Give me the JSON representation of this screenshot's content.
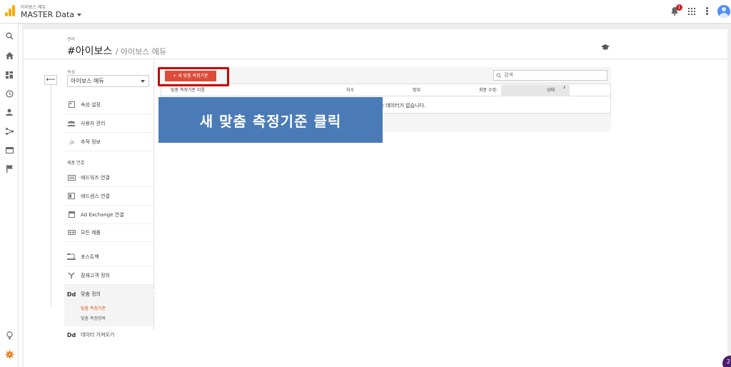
{
  "header": {
    "account_name": "아이보스 에듀",
    "property_name": "MASTER Data",
    "notification_count": "1"
  },
  "page": {
    "breadcrumb_label": "관리",
    "title": "#아이보스",
    "title_sub": "/ 아이보스 에듀"
  },
  "property_section": {
    "label": "속성",
    "selected": "아이보스 에듀"
  },
  "nav": {
    "items": [
      {
        "label": "속성 설정",
        "icon": "settings-page-icon"
      },
      {
        "label": "사용자 관리",
        "icon": "users-icon"
      },
      {
        "label": "추적 정보",
        "icon": "js-icon"
      }
    ],
    "product_linking_label": "제품 연결",
    "product_items": [
      {
        "label": "애드워즈 연결",
        "icon": "adwords-icon"
      },
      {
        "label": "애드센스 연결",
        "icon": "adsense-icon"
      },
      {
        "label": "Ad Exchange 연결",
        "icon": "ad-exchange-icon"
      },
      {
        "label": "모든 제품",
        "icon": "all-products-icon"
      }
    ],
    "extra_items": [
      {
        "label": "포스트백",
        "icon": "postback-icon"
      },
      {
        "label": "잠재고객 정의",
        "icon": "audience-icon"
      }
    ],
    "custom_definitions": {
      "label": "맞춤 정의",
      "icon_text": "Dd",
      "sub_items": [
        "맞춤 측정기준",
        "맞춤 측정항목"
      ]
    },
    "data_import": {
      "label": "데이터 가져오기",
      "icon_text": "Dd"
    }
  },
  "table": {
    "new_button_label": "+ 새 맞춤 측정기준",
    "search_placeholder": "검색",
    "columns": [
      "맞춤 측정기준 이름",
      "지수",
      "범위",
      "최종 수정:",
      "상태"
    ],
    "sort_indicator": "↓",
    "empty_message": "하는 데이터가 없습니다."
  },
  "banner": {
    "text": "새 맞춤 측정기준 클릭"
  },
  "corner_badge": "2",
  "colors": {
    "accent_red": "#dd4b39",
    "highlight_red": "#cc0000",
    "banner_blue": "#4a7bb7",
    "active_link": "#e0531a",
    "logo_orange": "#f9ab00"
  }
}
